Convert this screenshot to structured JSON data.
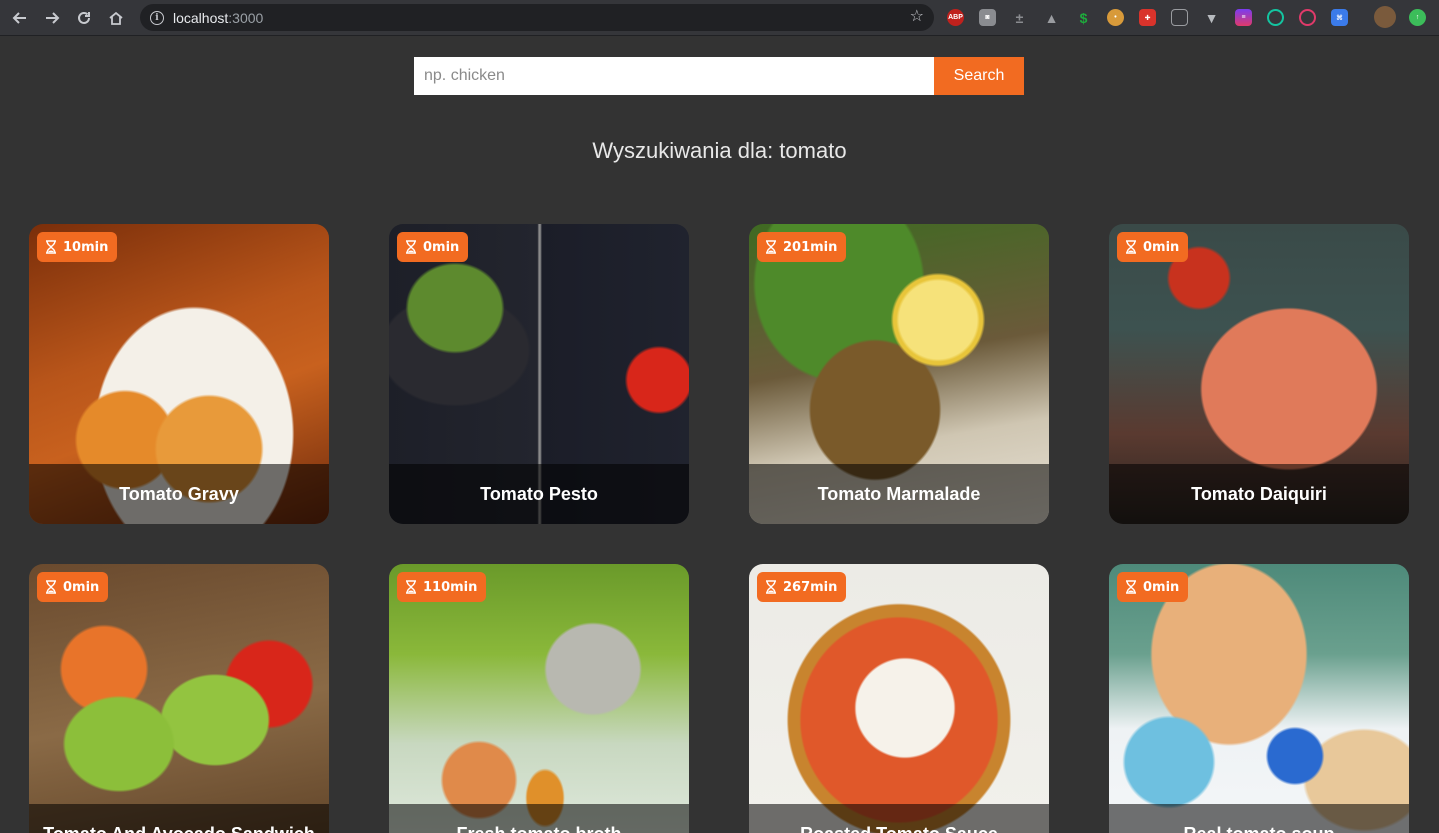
{
  "browser": {
    "host": "localhost",
    "port": ":3000"
  },
  "search": {
    "placeholder": "np. chicken",
    "button_label": "Search"
  },
  "results_heading": "Wyszukiwania dla: tomato",
  "accent_color": "#f26b21",
  "recipes": [
    {
      "title": "Tomato Gravy",
      "time": "10min"
    },
    {
      "title": "Tomato Pesto",
      "time": "0min"
    },
    {
      "title": "Tomato Marmalade",
      "time": "201min"
    },
    {
      "title": "Tomato Daiquiri",
      "time": "0min"
    },
    {
      "title": "Tomato And Avocado Sandwich",
      "time": "0min"
    },
    {
      "title": "Fresh tomato broth",
      "time": "110min"
    },
    {
      "title": "Roasted Tomato Sauce",
      "time": "267min"
    },
    {
      "title": "Real tomato soup",
      "time": "0min"
    }
  ]
}
